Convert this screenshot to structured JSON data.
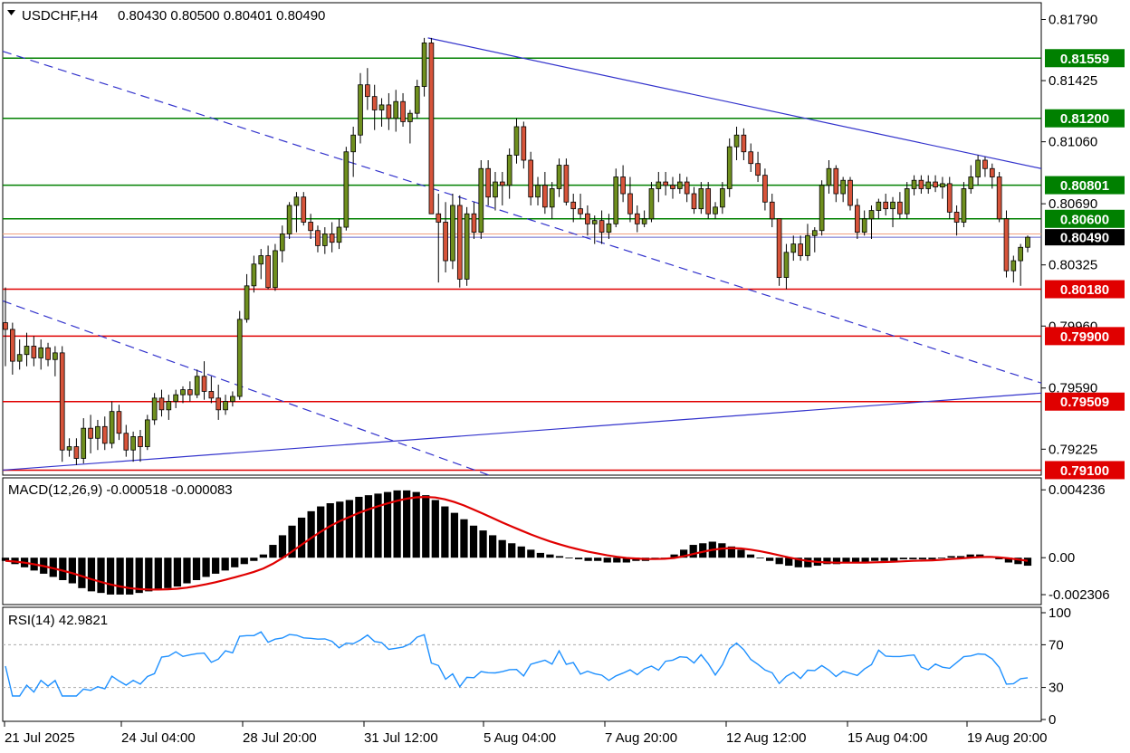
{
  "header": {
    "symbol": "USDCHF,H4",
    "ohlc": "0.80430 0.80500 0.80401 0.80490"
  },
  "colors": {
    "bull": "#6f8f1e",
    "bear": "#d7543a",
    "support": "#e00000",
    "resistance": "#008000",
    "trend": "#3333cc",
    "signal": "#e00000",
    "rsi": "#1e90ff"
  },
  "price_panel": {
    "axis_labels": [
      "0.81790",
      "0.81425",
      "0.81060",
      "0.80690",
      "0.80325",
      "0.79960",
      "0.79590",
      "0.79225"
    ],
    "ylim": [
      0.7907,
      0.8189
    ],
    "resistance_levels": [
      {
        "value": 0.81559,
        "label": "0.81559"
      },
      {
        "value": 0.812,
        "label": "0.81200"
      },
      {
        "value": 0.80801,
        "label": "0.80801"
      },
      {
        "value": 0.806,
        "label": "0.80600"
      }
    ],
    "support_levels": [
      {
        "value": 0.8018,
        "label": "0.80180"
      },
      {
        "value": 0.799,
        "label": "0.79900"
      },
      {
        "value": 0.79509,
        "label": "0.79509"
      },
      {
        "value": 0.791,
        "label": "0.79100"
      }
    ],
    "current_price": {
      "value": 0.8049,
      "label": "0.80490"
    },
    "bid_line": 0.8051
  },
  "macd_panel": {
    "title": "MACD(12,26,9) -0.000518 -0.000083",
    "axis_labels": [
      "0.004236",
      "0.00",
      "-0.002306"
    ],
    "ylim": [
      -0.0027,
      0.0047
    ]
  },
  "rsi_panel": {
    "title": "RSI(14) 42.9821",
    "axis_labels": [
      "100",
      "70",
      "30",
      "0"
    ],
    "levels": [
      70,
      30
    ]
  },
  "x_axis": {
    "labels": [
      "21 Jul 2025",
      "24 Jul 04:00",
      "28 Jul 20:00",
      "31 Jul 12:00",
      "5 Aug 04:00",
      "7 Aug 20:00",
      "12 Aug 12:00",
      "15 Aug 04:00",
      "19 Aug 20:00"
    ]
  },
  "chart_data": {
    "type": "candlestick",
    "title": "USDCHF,H4",
    "timeframe": "H4",
    "candles": [
      {
        "o": 0.7998,
        "h": 0.8019,
        "l": 0.7972,
        "c": 0.7994
      },
      {
        "o": 0.7994,
        "h": 0.7998,
        "l": 0.7967,
        "c": 0.7975
      },
      {
        "o": 0.7975,
        "h": 0.7988,
        "l": 0.797,
        "c": 0.7979
      },
      {
        "o": 0.7979,
        "h": 0.7992,
        "l": 0.7972,
        "c": 0.7984
      },
      {
        "o": 0.7984,
        "h": 0.799,
        "l": 0.7972,
        "c": 0.7977
      },
      {
        "o": 0.7977,
        "h": 0.7988,
        "l": 0.797,
        "c": 0.7983
      },
      {
        "o": 0.7983,
        "h": 0.7986,
        "l": 0.7972,
        "c": 0.7976
      },
      {
        "o": 0.7976,
        "h": 0.7984,
        "l": 0.7966,
        "c": 0.798
      },
      {
        "o": 0.798,
        "h": 0.7984,
        "l": 0.7915,
        "c": 0.7922
      },
      {
        "o": 0.7922,
        "h": 0.7929,
        "l": 0.7918,
        "c": 0.7924
      },
      {
        "o": 0.7924,
        "h": 0.7929,
        "l": 0.7913,
        "c": 0.7917
      },
      {
        "o": 0.7917,
        "h": 0.7941,
        "l": 0.7914,
        "c": 0.7935
      },
      {
        "o": 0.7935,
        "h": 0.7943,
        "l": 0.792,
        "c": 0.7929
      },
      {
        "o": 0.7929,
        "h": 0.794,
        "l": 0.7922,
        "c": 0.7936
      },
      {
        "o": 0.7936,
        "h": 0.7942,
        "l": 0.7922,
        "c": 0.7926
      },
      {
        "o": 0.7926,
        "h": 0.7951,
        "l": 0.7923,
        "c": 0.7945
      },
      {
        "o": 0.7945,
        "h": 0.7949,
        "l": 0.7928,
        "c": 0.7932
      },
      {
        "o": 0.7932,
        "h": 0.7937,
        "l": 0.7918,
        "c": 0.7922
      },
      {
        "o": 0.7922,
        "h": 0.7933,
        "l": 0.7915,
        "c": 0.793
      },
      {
        "o": 0.793,
        "h": 0.7934,
        "l": 0.7915,
        "c": 0.7924
      },
      {
        "o": 0.7924,
        "h": 0.7943,
        "l": 0.7922,
        "c": 0.794
      },
      {
        "o": 0.794,
        "h": 0.7956,
        "l": 0.7937,
        "c": 0.7953
      },
      {
        "o": 0.7953,
        "h": 0.7958,
        "l": 0.7942,
        "c": 0.7946
      },
      {
        "o": 0.7946,
        "h": 0.7955,
        "l": 0.794,
        "c": 0.7951
      },
      {
        "o": 0.7951,
        "h": 0.7958,
        "l": 0.7947,
        "c": 0.7955
      },
      {
        "o": 0.7955,
        "h": 0.796,
        "l": 0.795,
        "c": 0.7958
      },
      {
        "o": 0.7958,
        "h": 0.7963,
        "l": 0.7951,
        "c": 0.7955
      },
      {
        "o": 0.7955,
        "h": 0.797,
        "l": 0.7953,
        "c": 0.7966
      },
      {
        "o": 0.7966,
        "h": 0.7975,
        "l": 0.7952,
        "c": 0.7957
      },
      {
        "o": 0.7957,
        "h": 0.7966,
        "l": 0.795,
        "c": 0.7953
      },
      {
        "o": 0.7953,
        "h": 0.7961,
        "l": 0.794,
        "c": 0.7946
      },
      {
        "o": 0.7946,
        "h": 0.7955,
        "l": 0.7943,
        "c": 0.7951
      },
      {
        "o": 0.7951,
        "h": 0.7957,
        "l": 0.7948,
        "c": 0.7954
      },
      {
        "o": 0.7954,
        "h": 0.8005,
        "l": 0.7952,
        "c": 0.8
      },
      {
        "o": 0.8,
        "h": 0.8027,
        "l": 0.7998,
        "c": 0.802
      },
      {
        "o": 0.802,
        "h": 0.8038,
        "l": 0.8016,
        "c": 0.8033
      },
      {
        "o": 0.8033,
        "h": 0.8042,
        "l": 0.8024,
        "c": 0.8038
      },
      {
        "o": 0.8038,
        "h": 0.8044,
        "l": 0.8018,
        "c": 0.8019
      },
      {
        "o": 0.8019,
        "h": 0.8045,
        "l": 0.8017,
        "c": 0.8041
      },
      {
        "o": 0.8041,
        "h": 0.8056,
        "l": 0.8034,
        "c": 0.8051
      },
      {
        "o": 0.8051,
        "h": 0.807,
        "l": 0.8048,
        "c": 0.8068
      },
      {
        "o": 0.8068,
        "h": 0.8076,
        "l": 0.8052,
        "c": 0.8073
      },
      {
        "o": 0.8073,
        "h": 0.8076,
        "l": 0.8056,
        "c": 0.8058
      },
      {
        "o": 0.8058,
        "h": 0.8063,
        "l": 0.8048,
        "c": 0.8053
      },
      {
        "o": 0.8053,
        "h": 0.8056,
        "l": 0.804,
        "c": 0.8044
      },
      {
        "o": 0.8044,
        "h": 0.8055,
        "l": 0.8039,
        "c": 0.8051
      },
      {
        "o": 0.8051,
        "h": 0.8058,
        "l": 0.804,
        "c": 0.8046
      },
      {
        "o": 0.8046,
        "h": 0.806,
        "l": 0.8042,
        "c": 0.8055
      },
      {
        "o": 0.8055,
        "h": 0.8103,
        "l": 0.8053,
        "c": 0.81
      },
      {
        "o": 0.81,
        "h": 0.8115,
        "l": 0.8085,
        "c": 0.811
      },
      {
        "o": 0.811,
        "h": 0.8147,
        "l": 0.8105,
        "c": 0.814
      },
      {
        "o": 0.814,
        "h": 0.815,
        "l": 0.8125,
        "c": 0.8133
      },
      {
        "o": 0.8133,
        "h": 0.814,
        "l": 0.8113,
        "c": 0.8125
      },
      {
        "o": 0.8125,
        "h": 0.8132,
        "l": 0.8115,
        "c": 0.8128
      },
      {
        "o": 0.8128,
        "h": 0.8135,
        "l": 0.8113,
        "c": 0.812
      },
      {
        "o": 0.812,
        "h": 0.8137,
        "l": 0.8112,
        "c": 0.813
      },
      {
        "o": 0.813,
        "h": 0.8135,
        "l": 0.8115,
        "c": 0.8118
      },
      {
        "o": 0.8118,
        "h": 0.8125,
        "l": 0.8105,
        "c": 0.8123
      },
      {
        "o": 0.8123,
        "h": 0.8143,
        "l": 0.812,
        "c": 0.8139
      },
      {
        "o": 0.8139,
        "h": 0.8168,
        "l": 0.8133,
        "c": 0.8165
      },
      {
        "o": 0.8165,
        "h": 0.8168,
        "l": 0.807,
        "c": 0.8063
      },
      {
        "o": 0.8063,
        "h": 0.8075,
        "l": 0.8022,
        "c": 0.8058
      },
      {
        "o": 0.8058,
        "h": 0.807,
        "l": 0.8028,
        "c": 0.8035
      },
      {
        "o": 0.8035,
        "h": 0.8075,
        "l": 0.803,
        "c": 0.8068
      },
      {
        "o": 0.8068,
        "h": 0.8074,
        "l": 0.8019,
        "c": 0.8024
      },
      {
        "o": 0.8024,
        "h": 0.8067,
        "l": 0.802,
        "c": 0.8063
      },
      {
        "o": 0.8063,
        "h": 0.807,
        "l": 0.8048,
        "c": 0.8052
      },
      {
        "o": 0.8052,
        "h": 0.8095,
        "l": 0.8048,
        "c": 0.809
      },
      {
        "o": 0.809,
        "h": 0.8095,
        "l": 0.8068,
        "c": 0.8073
      },
      {
        "o": 0.8073,
        "h": 0.8088,
        "l": 0.8065,
        "c": 0.8082
      },
      {
        "o": 0.8082,
        "h": 0.8088,
        "l": 0.8068,
        "c": 0.808
      },
      {
        "o": 0.808,
        "h": 0.8102,
        "l": 0.8072,
        "c": 0.8098
      },
      {
        "o": 0.8098,
        "h": 0.812,
        "l": 0.8093,
        "c": 0.8115
      },
      {
        "o": 0.8115,
        "h": 0.8118,
        "l": 0.809,
        "c": 0.8095
      },
      {
        "o": 0.8095,
        "h": 0.81,
        "l": 0.8068,
        "c": 0.8073
      },
      {
        "o": 0.8073,
        "h": 0.8085,
        "l": 0.8068,
        "c": 0.808
      },
      {
        "o": 0.808,
        "h": 0.8088,
        "l": 0.8063,
        "c": 0.8067
      },
      {
        "o": 0.8067,
        "h": 0.8082,
        "l": 0.806,
        "c": 0.8078
      },
      {
        "o": 0.8078,
        "h": 0.8096,
        "l": 0.8073,
        "c": 0.8092
      },
      {
        "o": 0.8092,
        "h": 0.8096,
        "l": 0.8068,
        "c": 0.807
      },
      {
        "o": 0.807,
        "h": 0.8075,
        "l": 0.8058,
        "c": 0.8066
      },
      {
        "o": 0.8066,
        "h": 0.8075,
        "l": 0.806,
        "c": 0.8063
      },
      {
        "o": 0.8063,
        "h": 0.8068,
        "l": 0.805,
        "c": 0.8057
      },
      {
        "o": 0.8057,
        "h": 0.8062,
        "l": 0.8045,
        "c": 0.8059
      },
      {
        "o": 0.8059,
        "h": 0.8065,
        "l": 0.8045,
        "c": 0.8052
      },
      {
        "o": 0.8052,
        "h": 0.8063,
        "l": 0.8048,
        "c": 0.8057
      },
      {
        "o": 0.8057,
        "h": 0.809,
        "l": 0.8055,
        "c": 0.8085
      },
      {
        "o": 0.8085,
        "h": 0.8092,
        "l": 0.807,
        "c": 0.8075
      },
      {
        "o": 0.8075,
        "h": 0.8085,
        "l": 0.8058,
        "c": 0.8063
      },
      {
        "o": 0.8063,
        "h": 0.8068,
        "l": 0.8052,
        "c": 0.8057
      },
      {
        "o": 0.8057,
        "h": 0.8065,
        "l": 0.8055,
        "c": 0.806
      },
      {
        "o": 0.806,
        "h": 0.8082,
        "l": 0.8058,
        "c": 0.8078
      },
      {
        "o": 0.8078,
        "h": 0.8088,
        "l": 0.807,
        "c": 0.8082
      },
      {
        "o": 0.8082,
        "h": 0.8088,
        "l": 0.8074,
        "c": 0.808
      },
      {
        "o": 0.808,
        "h": 0.8085,
        "l": 0.8072,
        "c": 0.8078
      },
      {
        "o": 0.8078,
        "h": 0.8087,
        "l": 0.8075,
        "c": 0.8082
      },
      {
        "o": 0.8082,
        "h": 0.8085,
        "l": 0.807,
        "c": 0.8075
      },
      {
        "o": 0.8075,
        "h": 0.8079,
        "l": 0.8063,
        "c": 0.8066
      },
      {
        "o": 0.8066,
        "h": 0.8082,
        "l": 0.8063,
        "c": 0.8078
      },
      {
        "o": 0.8078,
        "h": 0.8082,
        "l": 0.806,
        "c": 0.8063
      },
      {
        "o": 0.8063,
        "h": 0.807,
        "l": 0.806,
        "c": 0.8067
      },
      {
        "o": 0.8067,
        "h": 0.8082,
        "l": 0.8063,
        "c": 0.8078
      },
      {
        "o": 0.8078,
        "h": 0.8108,
        "l": 0.8073,
        "c": 0.8103
      },
      {
        "o": 0.8103,
        "h": 0.8115,
        "l": 0.8095,
        "c": 0.811
      },
      {
        "o": 0.811,
        "h": 0.8114,
        "l": 0.8095,
        "c": 0.81
      },
      {
        "o": 0.81,
        "h": 0.8105,
        "l": 0.8088,
        "c": 0.8093
      },
      {
        "o": 0.8093,
        "h": 0.81,
        "l": 0.8082,
        "c": 0.8086
      },
      {
        "o": 0.8086,
        "h": 0.809,
        "l": 0.8065,
        "c": 0.807
      },
      {
        "o": 0.807,
        "h": 0.8075,
        "l": 0.8055,
        "c": 0.806
      },
      {
        "o": 0.806,
        "h": 0.806,
        "l": 0.802,
        "c": 0.8025
      },
      {
        "o": 0.8025,
        "h": 0.8045,
        "l": 0.8018,
        "c": 0.804
      },
      {
        "o": 0.804,
        "h": 0.805,
        "l": 0.8035,
        "c": 0.8045
      },
      {
        "o": 0.8045,
        "h": 0.805,
        "l": 0.8035,
        "c": 0.8038
      },
      {
        "o": 0.8038,
        "h": 0.8057,
        "l": 0.8035,
        "c": 0.805
      },
      {
        "o": 0.805,
        "h": 0.8055,
        "l": 0.804,
        "c": 0.8053
      },
      {
        "o": 0.8053,
        "h": 0.8083,
        "l": 0.805,
        "c": 0.808
      },
      {
        "o": 0.808,
        "h": 0.8095,
        "l": 0.8075,
        "c": 0.809
      },
      {
        "o": 0.809,
        "h": 0.8092,
        "l": 0.807,
        "c": 0.8075
      },
      {
        "o": 0.8075,
        "h": 0.8085,
        "l": 0.807,
        "c": 0.8083
      },
      {
        "o": 0.8083,
        "h": 0.8085,
        "l": 0.8065,
        "c": 0.8068
      },
      {
        "o": 0.8068,
        "h": 0.8072,
        "l": 0.8048,
        "c": 0.8052
      },
      {
        "o": 0.8052,
        "h": 0.8065,
        "l": 0.805,
        "c": 0.806
      },
      {
        "o": 0.806,
        "h": 0.8068,
        "l": 0.8048,
        "c": 0.8065
      },
      {
        "o": 0.8065,
        "h": 0.8072,
        "l": 0.806,
        "c": 0.807
      },
      {
        "o": 0.807,
        "h": 0.8075,
        "l": 0.8062,
        "c": 0.8066
      },
      {
        "o": 0.8066,
        "h": 0.8073,
        "l": 0.8055,
        "c": 0.807
      },
      {
        "o": 0.807,
        "h": 0.8076,
        "l": 0.806,
        "c": 0.8063
      },
      {
        "o": 0.8063,
        "h": 0.8082,
        "l": 0.806,
        "c": 0.8078
      },
      {
        "o": 0.8078,
        "h": 0.8086,
        "l": 0.8074,
        "c": 0.8083
      },
      {
        "o": 0.8083,
        "h": 0.8086,
        "l": 0.8075,
        "c": 0.8078
      },
      {
        "o": 0.8078,
        "h": 0.8086,
        "l": 0.8075,
        "c": 0.8082
      },
      {
        "o": 0.8082,
        "h": 0.8086,
        "l": 0.8076,
        "c": 0.8079
      },
      {
        "o": 0.8079,
        "h": 0.8085,
        "l": 0.8072,
        "c": 0.8081
      },
      {
        "o": 0.8081,
        "h": 0.8085,
        "l": 0.806,
        "c": 0.8064
      },
      {
        "o": 0.8064,
        "h": 0.8068,
        "l": 0.805,
        "c": 0.8058
      },
      {
        "o": 0.8058,
        "h": 0.8082,
        "l": 0.8055,
        "c": 0.8078
      },
      {
        "o": 0.8078,
        "h": 0.8092,
        "l": 0.8075,
        "c": 0.8085
      },
      {
        "o": 0.8085,
        "h": 0.8098,
        "l": 0.808,
        "c": 0.8095
      },
      {
        "o": 0.8095,
        "h": 0.8097,
        "l": 0.8085,
        "c": 0.809
      },
      {
        "o": 0.809,
        "h": 0.8093,
        "l": 0.8078,
        "c": 0.8085
      },
      {
        "o": 0.8085,
        "h": 0.8088,
        "l": 0.8058,
        "c": 0.806
      },
      {
        "o": 0.806,
        "h": 0.8065,
        "l": 0.8025,
        "c": 0.8029
      },
      {
        "o": 0.8029,
        "h": 0.8038,
        "l": 0.8022,
        "c": 0.8035
      },
      {
        "o": 0.8035,
        "h": 0.8045,
        "l": 0.802,
        "c": 0.8043
      },
      {
        "o": 0.8043,
        "h": 0.805,
        "l": 0.804,
        "c": 0.8049
      }
    ],
    "macd": {
      "line": -0.000518,
      "signal": -8.3e-05,
      "histogram": [
        -0.0002,
        -0.0004,
        -0.0006,
        -0.0008,
        -0.001,
        -0.0012,
        -0.0014,
        -0.0016,
        -0.0019,
        -0.0021,
        -0.0022,
        -0.0023,
        -0.0023,
        -0.0023,
        -0.0022,
        -0.0021,
        -0.002,
        -0.0019,
        -0.0018,
        -0.0016,
        -0.0014,
        -0.0012,
        -0.001,
        -0.0008,
        -0.0006,
        -0.0004,
        -0.0002,
        0.0002,
        0.0008,
        0.0014,
        0.002,
        0.0025,
        0.0029,
        0.0032,
        0.0034,
        0.0035,
        0.0036,
        0.0038,
        0.0039,
        0.004,
        0.0041,
        0.0042,
        0.0042,
        0.0041,
        0.0039,
        0.0036,
        0.0032,
        0.0028,
        0.0024,
        0.002,
        0.0017,
        0.0014,
        0.0011,
        0.0009,
        0.0007,
        0.0005,
        0.0003,
        0.0002,
        0.0001,
        0.0,
        -0.0001,
        -0.0002,
        -0.0002,
        -0.0003,
        -0.0003,
        -0.0003,
        -0.0002,
        -0.0002,
        -0.0001,
        0.0,
        0.0002,
        0.0005,
        0.0008,
        0.0009,
        0.001,
        0.0009,
        0.0007,
        0.0005,
        0.0002,
        0.0,
        -0.0002,
        -0.0004,
        -0.0005,
        -0.0006,
        -0.0006,
        -0.0005,
        -0.0004,
        -0.0004,
        -0.0003,
        -0.0003,
        -0.0003,
        -0.0002,
        -0.0002,
        -0.0002,
        -0.0001,
        -0.0001,
        -0.0001,
        -0.0001,
        0.0,
        0.0001,
        0.0001,
        0.0002,
        0.0002,
        0.0001,
        -0.0001,
        -0.0003,
        -0.0004,
        -0.0005
      ]
    },
    "rsi_last": 42.9821
  }
}
